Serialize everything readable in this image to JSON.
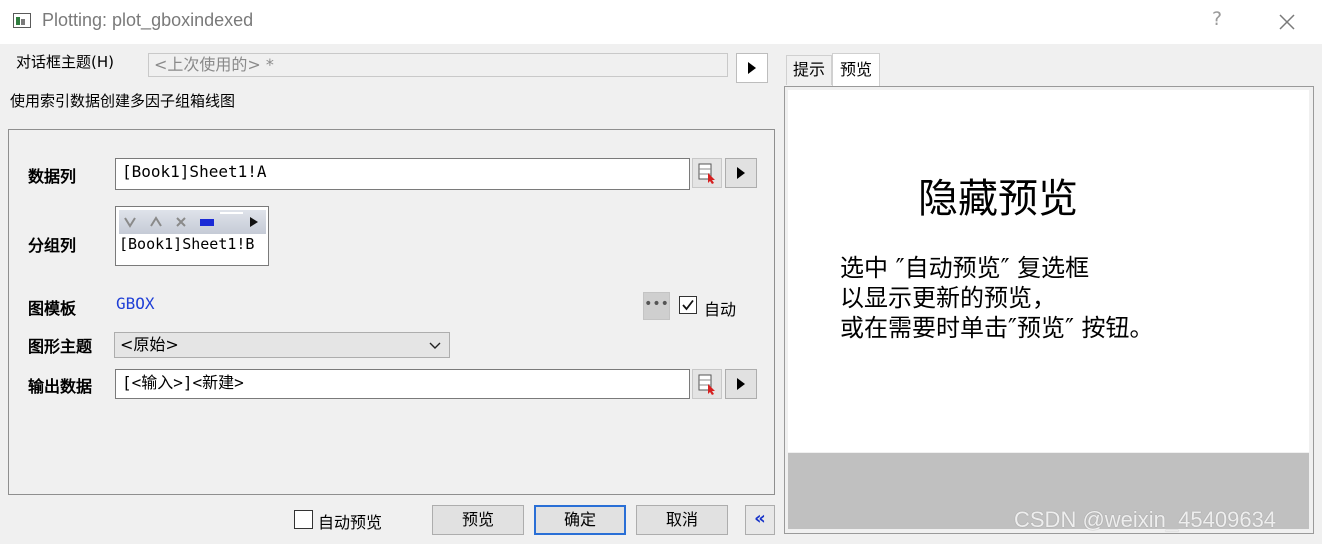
{
  "window": {
    "title": "Plotting: plot_gboxindexed",
    "help_label": "?"
  },
  "dialog_theme": {
    "label": "对话框主题(H)",
    "value": "<上次使用的> *"
  },
  "description": "使用索引数据创建多因子组箱线图",
  "fields": {
    "data_column": {
      "label": "数据列",
      "value": "[Book1]Sheet1!A"
    },
    "group_column": {
      "label": "分组列",
      "value": "[Book1]Sheet1!B"
    },
    "template": {
      "label": "图模板",
      "value": "GBOX",
      "more_label": "•••",
      "auto_label": "自动",
      "auto_checked": true
    },
    "graph_theme": {
      "label": "图形主题",
      "value": "<原始>"
    },
    "output": {
      "label": "输出数据",
      "value": "[<输入>]<新建>"
    }
  },
  "bottom": {
    "auto_preview_label": "自动预览",
    "auto_preview_checked": false,
    "preview_label": "预览",
    "ok_label": "确定",
    "cancel_label": "取消",
    "collapse_label": "«"
  },
  "tabs": [
    {
      "label": "提示",
      "active": false
    },
    {
      "label": "预览",
      "active": true
    }
  ],
  "preview": {
    "title": "隐藏预览",
    "message_lines": [
      "选中 ″自动预览″ 复选框",
      "以显示更新的预览，",
      "或在需要时单击″预览″ 按钮。"
    ]
  },
  "watermark": "CSDN @weixin_45409634",
  "colors": {
    "accent": "#2a6fd6",
    "template_link": "#1f3fd6",
    "collapse_icon": "#1733c9"
  }
}
